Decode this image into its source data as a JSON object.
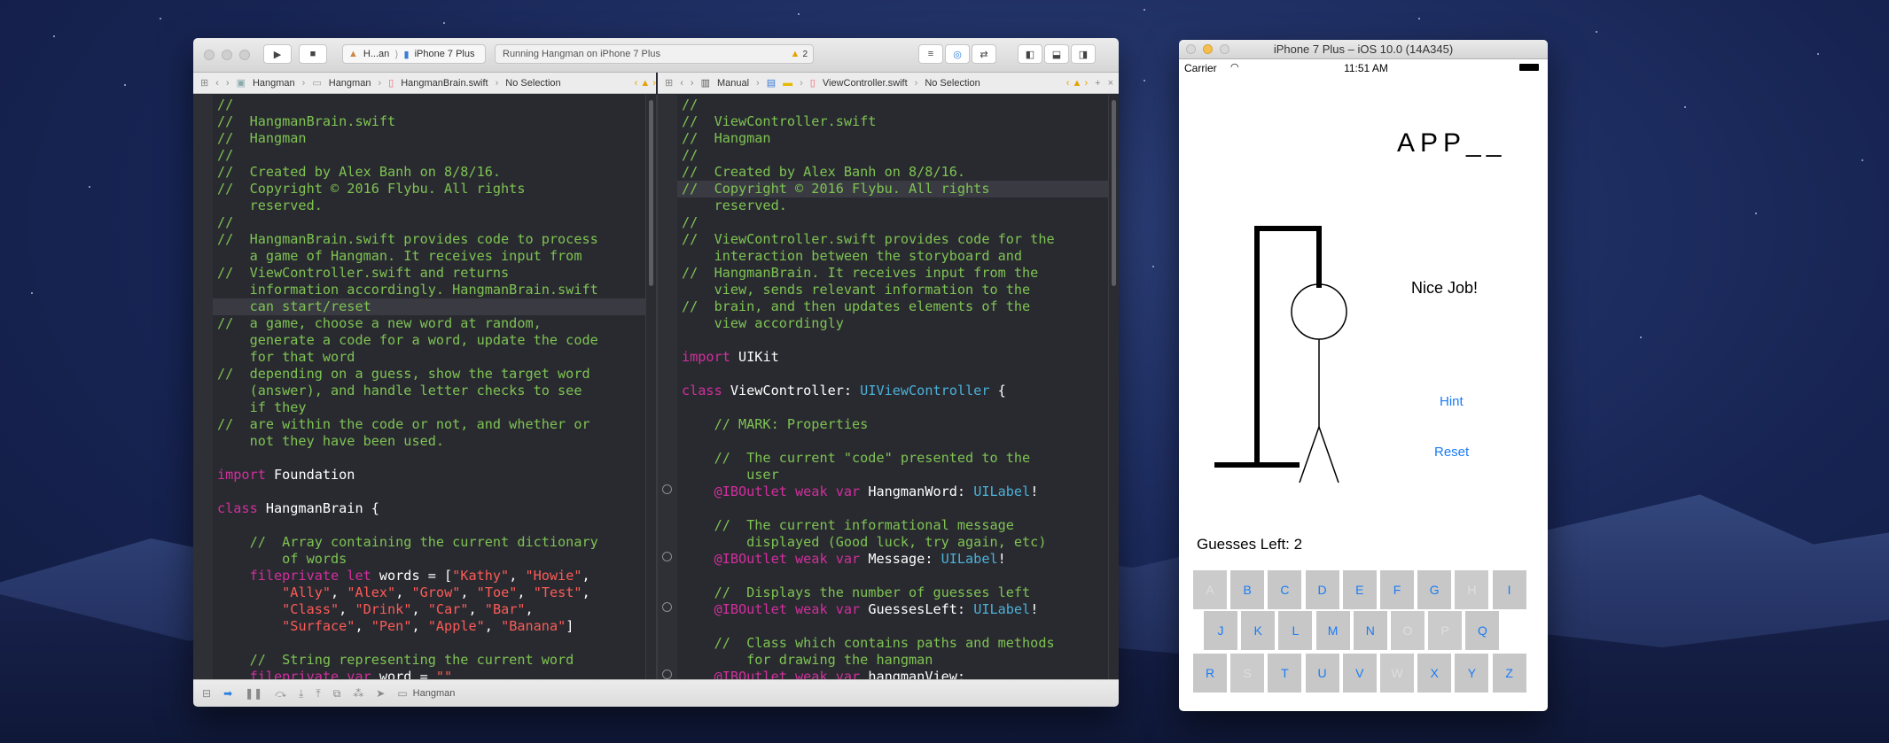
{
  "xcode": {
    "toolbar": {
      "scheme_app": "H...an",
      "scheme_device": "iPhone 7 Plus",
      "activity": "Running Hangman on iPhone 7 Plus",
      "warning_count": "2"
    },
    "left_jump": [
      "Hangman",
      "Hangman",
      "HangmanBrain.swift",
      "No Selection"
    ],
    "right_jump": [
      "Manual",
      "ViewController.swift",
      "No Selection"
    ],
    "debug_target": "Hangman"
  },
  "left_code": [
    [
      [
        "//",
        "c"
      ]
    ],
    [
      [
        "//  HangmanBrain.swift",
        "c"
      ]
    ],
    [
      [
        "//  Hangman",
        "c"
      ]
    ],
    [
      [
        "//",
        "c"
      ]
    ],
    [
      [
        "//  Created by Alex Banh on 8/8/16.",
        "c"
      ]
    ],
    [
      [
        "//  Copyright © 2016 Flybu. All rights",
        "c"
      ]
    ],
    [
      [
        "    reserved.",
        "c"
      ]
    ],
    [
      [
        "//",
        "c"
      ]
    ],
    [
      [
        "//  HangmanBrain.swift provides code to process",
        "c"
      ]
    ],
    [
      [
        "    a game of Hangman. It receives input from",
        "c"
      ]
    ],
    [
      [
        "//  ViewController.swift and returns",
        "c"
      ]
    ],
    [
      [
        "    information accordingly. HangmanBrain.swift",
        "c"
      ]
    ],
    [
      [
        "    can start/reset",
        "c"
      ]
    ],
    [
      [
        "//  a game, choose a new word at random,",
        "c"
      ]
    ],
    [
      [
        "    generate a code for a word, update the code",
        "c"
      ]
    ],
    [
      [
        "    for that word",
        "c"
      ]
    ],
    [
      [
        "//  depending on a guess, show the target word",
        "c"
      ]
    ],
    [
      [
        "    (answer), and handle letter checks to see",
        "c"
      ]
    ],
    [
      [
        "    if they",
        "c"
      ]
    ],
    [
      [
        "//  are within the code or not, and whether or",
        "c"
      ]
    ],
    [
      [
        "    not they have been used.",
        "c"
      ]
    ],
    [
      [
        "",
        ""
      ]
    ],
    [
      [
        "import",
        "k"
      ],
      [
        " Foundation",
        "p"
      ]
    ],
    [
      [
        "",
        ""
      ]
    ],
    [
      [
        "class",
        "k"
      ],
      [
        " HangmanBrain {",
        "p"
      ]
    ],
    [
      [
        "",
        ""
      ]
    ],
    [
      [
        "    //  Array containing the current dictionary",
        "c"
      ]
    ],
    [
      [
        "        of words",
        "c"
      ]
    ],
    [
      [
        "    ",
        "p"
      ],
      [
        "fileprivate let",
        "k"
      ],
      [
        " words = [",
        "p"
      ],
      [
        "\"Kathy\"",
        "s"
      ],
      [
        ", ",
        "p"
      ],
      [
        "\"Howie\"",
        "s"
      ],
      [
        ",",
        "p"
      ]
    ],
    [
      [
        "        ",
        "p"
      ],
      [
        "\"Ally\"",
        "s"
      ],
      [
        ", ",
        "p"
      ],
      [
        "\"Alex\"",
        "s"
      ],
      [
        ", ",
        "p"
      ],
      [
        "\"Grow\"",
        "s"
      ],
      [
        ", ",
        "p"
      ],
      [
        "\"Toe\"",
        "s"
      ],
      [
        ", ",
        "p"
      ],
      [
        "\"Test\"",
        "s"
      ],
      [
        ",",
        "p"
      ]
    ],
    [
      [
        "        ",
        "p"
      ],
      [
        "\"Class\"",
        "s"
      ],
      [
        ", ",
        "p"
      ],
      [
        "\"Drink\"",
        "s"
      ],
      [
        ", ",
        "p"
      ],
      [
        "\"Car\"",
        "s"
      ],
      [
        ", ",
        "p"
      ],
      [
        "\"Bar\"",
        "s"
      ],
      [
        ",",
        "p"
      ]
    ],
    [
      [
        "        ",
        "p"
      ],
      [
        "\"Surface\"",
        "s"
      ],
      [
        ", ",
        "p"
      ],
      [
        "\"Pen\"",
        "s"
      ],
      [
        ", ",
        "p"
      ],
      [
        "\"Apple\"",
        "s"
      ],
      [
        ", ",
        "p"
      ],
      [
        "\"Banana\"",
        "s"
      ],
      [
        "]",
        "p"
      ]
    ],
    [
      [
        "",
        ""
      ]
    ],
    [
      [
        "    //  String representing the current word",
        "c"
      ]
    ],
    [
      [
        "    ",
        "p"
      ],
      [
        "fileprivate var",
        "k"
      ],
      [
        " word = ",
        "p"
      ],
      [
        "\"\"",
        "s"
      ]
    ]
  ],
  "right_code": [
    [
      [
        "//",
        "c"
      ]
    ],
    [
      [
        "//  ViewController.swift",
        "c"
      ]
    ],
    [
      [
        "//  Hangman",
        "c"
      ]
    ],
    [
      [
        "//",
        "c"
      ]
    ],
    [
      [
        "//  Created by Alex Banh on 8/8/16.",
        "c"
      ]
    ],
    [
      [
        "//  Copyright © 2016 Flybu. All rights",
        "c"
      ]
    ],
    [
      [
        "    reserved.",
        "c"
      ]
    ],
    [
      [
        "//",
        "c"
      ]
    ],
    [
      [
        "//  ViewController.swift provides code for the",
        "c"
      ]
    ],
    [
      [
        "    interaction between the storyboard and",
        "c"
      ]
    ],
    [
      [
        "//  HangmanBrain. It receives input from the",
        "c"
      ]
    ],
    [
      [
        "    view, sends relevant information to the",
        "c"
      ]
    ],
    [
      [
        "//  brain, and then updates elements of the",
        "c"
      ]
    ],
    [
      [
        "    view accordingly",
        "c"
      ]
    ],
    [
      [
        "",
        ""
      ]
    ],
    [
      [
        "import",
        "k"
      ],
      [
        " UIKit",
        "p"
      ]
    ],
    [
      [
        "",
        ""
      ]
    ],
    [
      [
        "class",
        "k"
      ],
      [
        " ViewController: ",
        "p"
      ],
      [
        "UIViewController",
        "t"
      ],
      [
        " {",
        "p"
      ]
    ],
    [
      [
        "",
        ""
      ]
    ],
    [
      [
        "    // MARK: Properties",
        "c"
      ]
    ],
    [
      [
        "",
        ""
      ]
    ],
    [
      [
        "    //  The current \"code\" presented to the",
        "c"
      ]
    ],
    [
      [
        "        user",
        "c"
      ]
    ],
    [
      [
        "    ",
        "p"
      ],
      [
        "@IBOutlet weak var",
        "k"
      ],
      [
        " HangmanWord: ",
        "p"
      ],
      [
        "UILabel",
        "t"
      ],
      [
        "!",
        "p"
      ]
    ],
    [
      [
        "",
        ""
      ]
    ],
    [
      [
        "    //  The current informational message",
        "c"
      ]
    ],
    [
      [
        "        displayed (Good luck, try again, etc)",
        "c"
      ]
    ],
    [
      [
        "    ",
        "p"
      ],
      [
        "@IBOutlet weak var",
        "k"
      ],
      [
        " Message: ",
        "p"
      ],
      [
        "UILabel",
        "t"
      ],
      [
        "!",
        "p"
      ]
    ],
    [
      [
        "",
        ""
      ]
    ],
    [
      [
        "    //  Displays the number of guesses left",
        "c"
      ]
    ],
    [
      [
        "    ",
        "p"
      ],
      [
        "@IBOutlet weak var",
        "k"
      ],
      [
        " GuessesLeft: ",
        "p"
      ],
      [
        "UILabel",
        "t"
      ],
      [
        "!",
        "p"
      ]
    ],
    [
      [
        "",
        ""
      ]
    ],
    [
      [
        "    //  Class which contains paths and methods",
        "c"
      ]
    ],
    [
      [
        "        for drawing the hangman",
        "c"
      ]
    ],
    [
      [
        "    ",
        "p"
      ],
      [
        "@IBOutlet weak var",
        "k"
      ],
      [
        " hangmanView:",
        "p"
      ]
    ]
  ],
  "simulator": {
    "title": "iPhone 7 Plus – iOS 10.0 (14A345)",
    "carrier": "Carrier",
    "time": "11:51 AM",
    "word": "APP__",
    "message": "Nice Job!",
    "hint_label": "Hint",
    "reset_label": "Reset",
    "guesses_label": "Guesses Left: 2",
    "keyboard_rows": [
      [
        "A",
        "B",
        "C",
        "D",
        "E",
        "F",
        "G",
        "H",
        "I"
      ],
      [
        "J",
        "K",
        "L",
        "M",
        "N",
        "O",
        "P",
        "Q"
      ],
      [
        "R",
        "S",
        "T",
        "U",
        "V",
        "W",
        "X",
        "Y",
        "Z"
      ]
    ],
    "used_letters": [
      "A",
      "H",
      "O",
      "P",
      "S",
      "W"
    ]
  }
}
